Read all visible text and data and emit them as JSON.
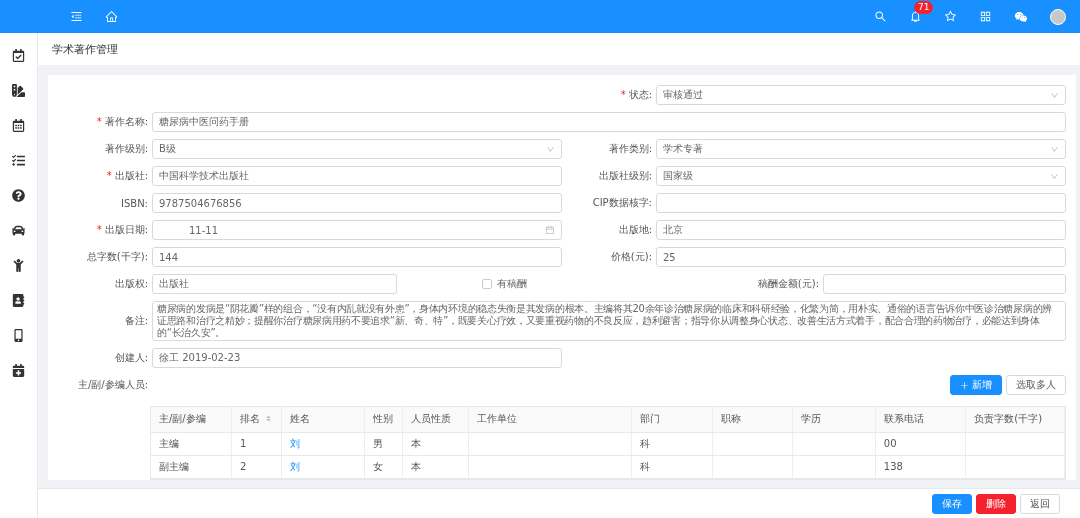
{
  "header": {
    "notification_count": "71"
  },
  "page_title": "学术著作管理",
  "form": {
    "rows": [
      {
        "kind": "right",
        "fields": [
          {
            "label": "状态:",
            "mark": "*",
            "kind": "select",
            "value": "审核通过"
          }
        ]
      },
      {
        "kind": "full",
        "fields": [
          {
            "label": "著作名称:",
            "mark": "*",
            "kind": "input",
            "value": "糖尿病中医问药手册"
          }
        ]
      },
      {
        "kind": "pair",
        "fields": [
          {
            "label": "著作级别:",
            "kind": "select",
            "value": "B级"
          },
          {
            "label": "著作类别:",
            "kind": "select",
            "value": "学术专著"
          }
        ]
      },
      {
        "kind": "pair",
        "fields": [
          {
            "label": "出版社:",
            "mark": "*",
            "kind": "input",
            "value": "中国科学技术出版社"
          },
          {
            "label": "出版社级别:",
            "kind": "select",
            "value": "国家级"
          }
        ]
      },
      {
        "kind": "pair",
        "fields": [
          {
            "label": "ISBN:",
            "kind": "input",
            "value": "9787504676856"
          },
          {
            "label": "CIP数据核字:",
            "kind": "input"
          }
        ]
      },
      {
        "kind": "pair",
        "fields": [
          {
            "label": "出版日期:",
            "mark": "*",
            "kind": "date",
            "value": "11-11"
          },
          {
            "label": "出版地:",
            "kind": "input",
            "value": "北京"
          }
        ]
      },
      {
        "kind": "pair",
        "fields": [
          {
            "label": "总字数(千字):",
            "kind": "input",
            "value": "144"
          },
          {
            "label": "价格(元):",
            "kind": "input",
            "value": "25"
          }
        ]
      },
      {
        "kind": "triple",
        "fields": [
          {
            "label": "出版权:",
            "kind": "input",
            "value": "出版社"
          },
          {
            "label": "有稿酬",
            "kind": "checkbox",
            "checked": false
          },
          {
            "label": "稿酬金额(元):",
            "kind": "input"
          }
        ]
      },
      {
        "kind": "full",
        "fields": [
          {
            "label": "备注:",
            "kind": "textarea",
            "value": "糖尿病的发病是“阴花瓣”样的组合，“没有内乱就没有外患”，身体内环境的稳态失衡是其发病的根本。主编将其20余年诊治糖尿病的临床和科研经验，化繁为简，用朴实、通俗的语言告诉你中医诊治糖尿病的辨证思路和治疗之精妙；提醒你治疗糖尿病用药不要追求“新、奇、特”，既要关心疗效，又要重视药物的不良反应，趋利避害；指导你从调整身心状态、改善生活方式着手，配合合理的药物治疗，必能达到身体的“长治久安”。"
          }
        ]
      },
      {
        "kind": "half",
        "fields": [
          {
            "label": "创建人:",
            "kind": "input",
            "value": "徐工 2019-02-23"
          }
        ]
      }
    ]
  },
  "editors": {
    "label": "主/副/参编人员:",
    "buttons": [
      {
        "kind": "primary",
        "label": "新增"
      },
      {
        "kind": "default",
        "label": "选取多人"
      }
    ],
    "table": {
      "columns": [
        {
          "label": "主/副/参编",
          "sortable": false
        },
        {
          "label": "排名",
          "sortable": true
        },
        {
          "label": "姓名",
          "sortable": false
        },
        {
          "label": "性别",
          "sortable": false
        },
        {
          "label": "人员性质",
          "sortable": false
        },
        {
          "label": "工作单位",
          "sortable": false
        },
        {
          "label": "部门",
          "sortable": false
        },
        {
          "label": "职称",
          "sortable": false
        },
        {
          "label": "学历",
          "sortable": false
        },
        {
          "label": "联系电话",
          "sortable": false
        },
        {
          "label": "负责字数(千字)",
          "sortable": false
        }
      ],
      "rows": [
        [
          "主编",
          "1",
          "刘",
          "男",
          "本",
          null,
          "科",
          null,
          null,
          "00",
          null
        ],
        [
          "副主编",
          "2",
          "刘",
          "女",
          "本",
          null,
          "科",
          null,
          null,
          "138",
          null
        ]
      ]
    }
  },
  "footer_buttons": [
    {
      "kind": "primary",
      "label": "保存"
    },
    {
      "kind": "danger",
      "label": "删除"
    },
    {
      "kind": "default",
      "label": "返回"
    }
  ]
}
